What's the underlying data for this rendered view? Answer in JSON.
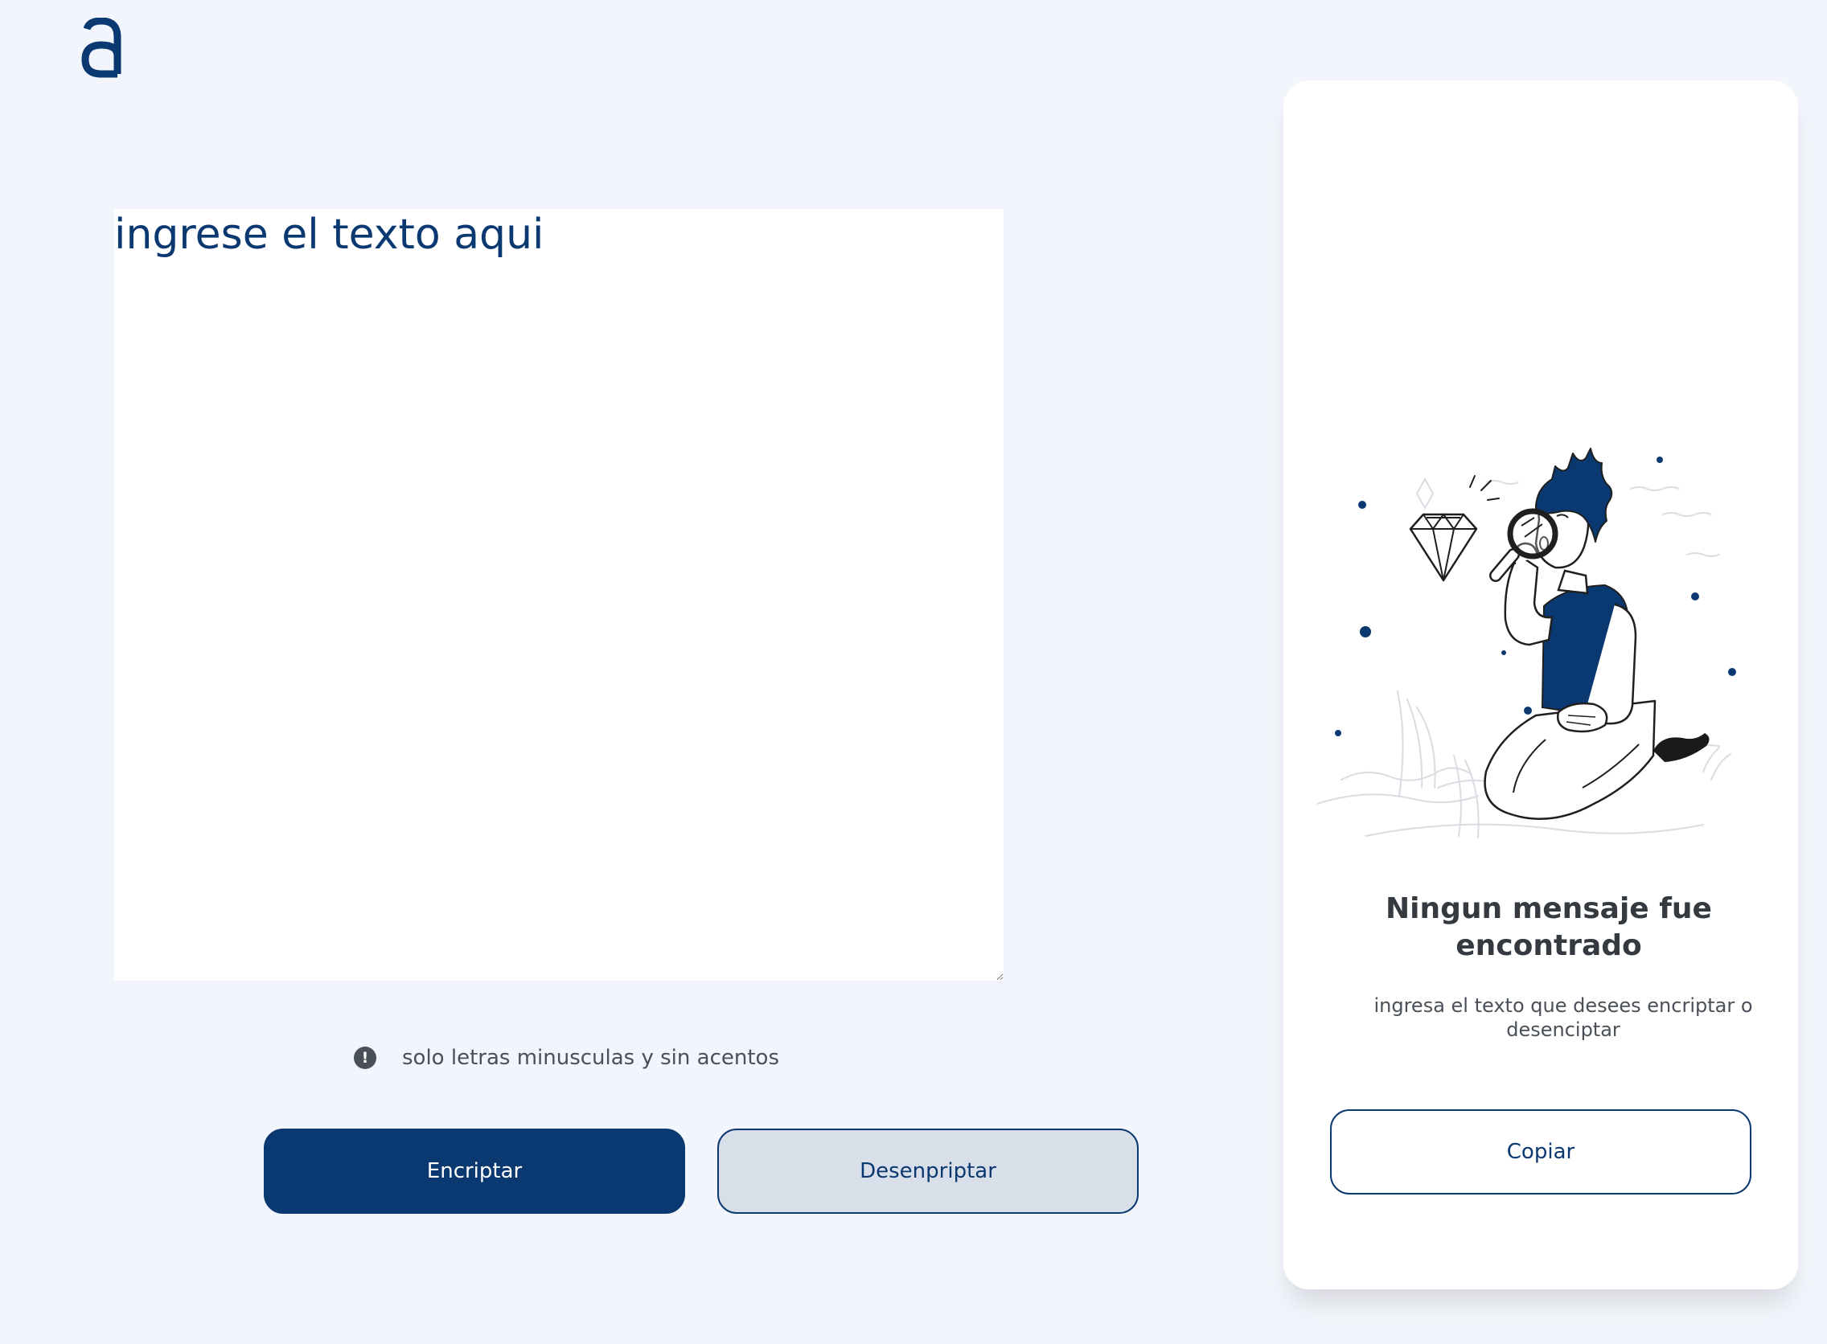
{
  "brand": {
    "logo_icon": "alura-logo-icon",
    "accent_color": "#0A3871",
    "background_color": "#F3F5FC"
  },
  "editor": {
    "placeholder": "ingrese el texto aqui",
    "value": ""
  },
  "hint": {
    "icon": "exclamation-circle-icon",
    "text": "solo letras minusculas y sin acentos"
  },
  "actions": {
    "encrypt_label": "Encriptar",
    "decrypt_label": "Desenpriptar"
  },
  "output_panel": {
    "illustration": "person-with-magnifying-glass-illustration",
    "title": "Ningun mensaje fue encontrado",
    "subtitle": "ingresa el texto que desees encriptar o desenciptar",
    "copy_label": "Copiar"
  }
}
